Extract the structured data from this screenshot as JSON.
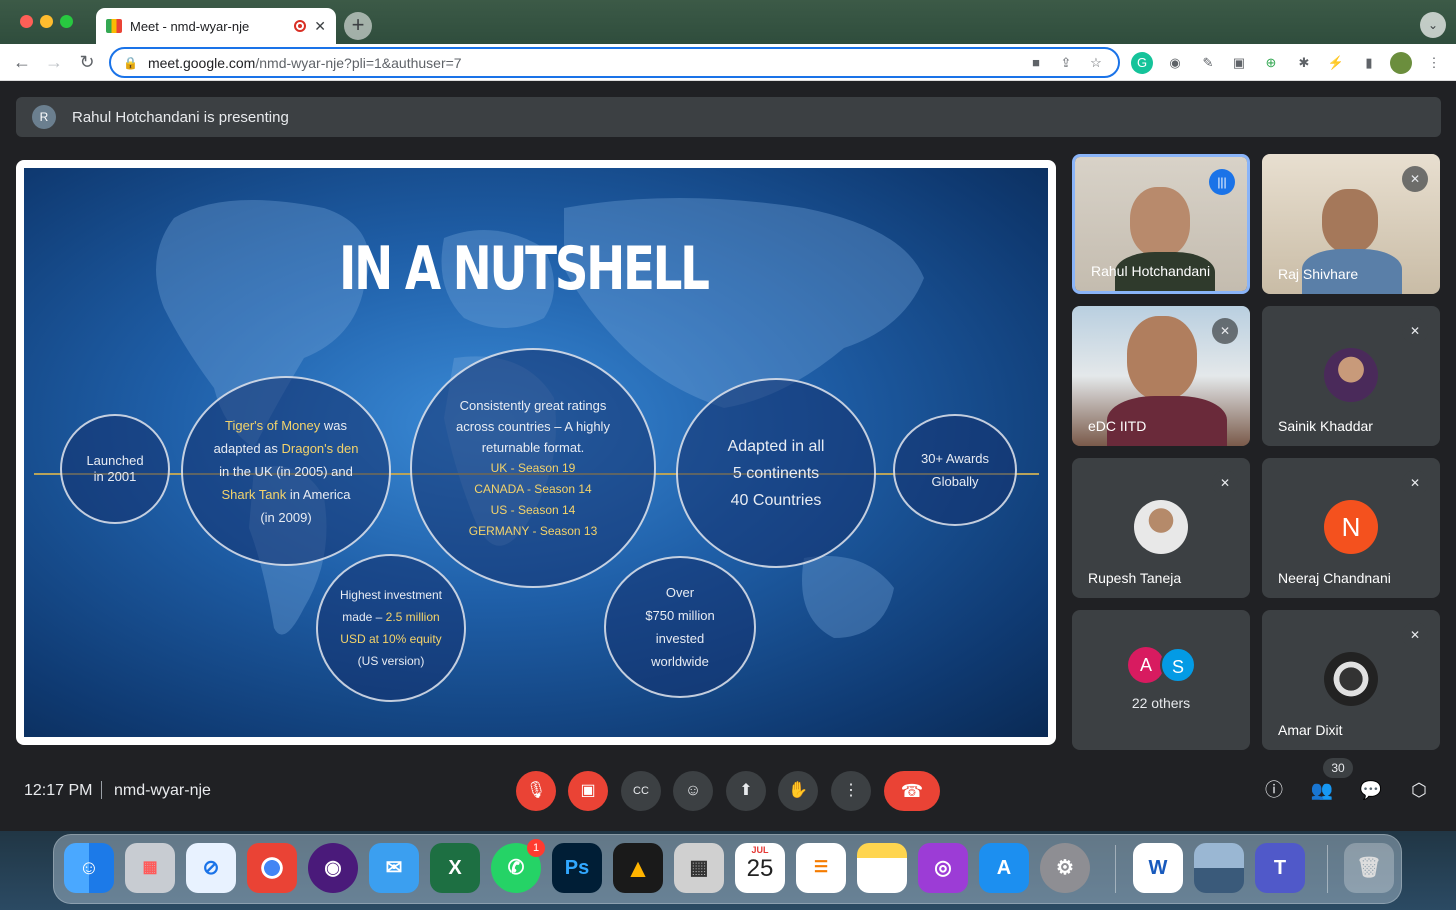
{
  "browser": {
    "tab_title": "Meet - nmd-wyar-nje",
    "url_host": "meet.google.com",
    "url_path": "/nmd-wyar-nje?pli=1&authuser=7"
  },
  "meet": {
    "presenting_initial": "R",
    "presenting_text": "Rahul Hotchandani is presenting",
    "time": "12:17 PM",
    "meeting_code": "nmd-wyar-nje",
    "participant_count": "30"
  },
  "slide": {
    "title": "IN A NUTSHELL",
    "launched": [
      "Launched",
      "in 2001"
    ],
    "tigers": {
      "l1a": "Tiger's of Money",
      "l1b": " was",
      "l2a": "adapted as ",
      "l2b": "Dragon's den",
      "l3": "in the UK (in 2005) and",
      "l4a": "Shark Tank",
      "l4b": " in America",
      "l5": "(in 2009)"
    },
    "ratings": {
      "l1": "Consistently great ratings",
      "l2": "across countries – A highly",
      "l3": "returnable format.",
      "s1": "UK -  Season 19",
      "s2": "CANADA - Season 14",
      "s3": "US - Season 14",
      "s4": "GERMANY - Season 13"
    },
    "continents": [
      "Adapted in all",
      "5 continents",
      "40  Countries"
    ],
    "awards": [
      "30+ Awards",
      "Globally"
    ],
    "investment": {
      "l1": "Highest investment",
      "l2a": "made – ",
      "l2b": "2.5 million",
      "l3a": "USD at 10% equity",
      "l4": "(US version)"
    },
    "over": [
      "Over",
      "$750 million",
      "invested",
      "worldwide"
    ]
  },
  "participants": [
    {
      "name": "Rahul Hotchandani"
    },
    {
      "name": "Raj Shivhare"
    },
    {
      "name": "eDC IITD"
    },
    {
      "name": "Sainik Khaddar"
    },
    {
      "name": "Rupesh Taneja"
    },
    {
      "name": "Neeraj Chandnani",
      "initial": "N"
    },
    {
      "name": "22 others",
      "initials": [
        "A",
        "S"
      ]
    },
    {
      "name": "Amar Dixit"
    }
  ],
  "dock": {
    "calendar_month": "JUL",
    "calendar_day": "25",
    "whatsapp_badge": "1"
  },
  "colors": {
    "meet_bg": "#202124",
    "end_call": "#ea4335",
    "active_border": "#8ab4f8"
  }
}
